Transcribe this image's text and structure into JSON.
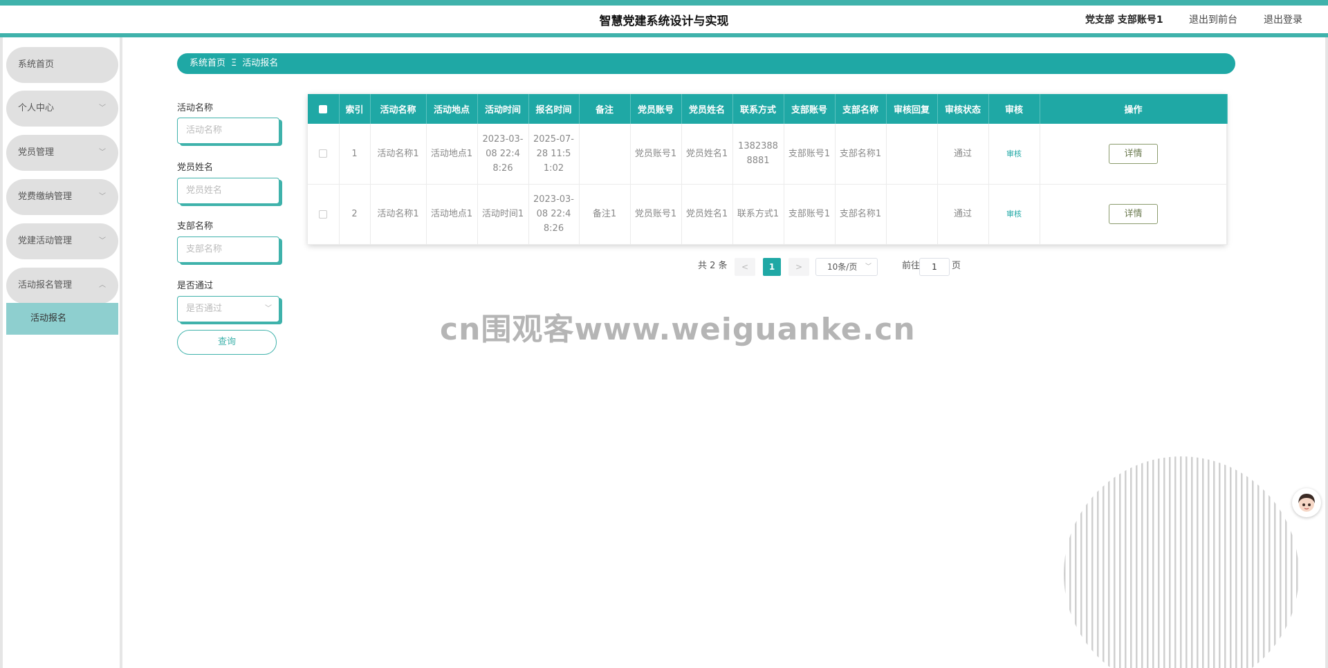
{
  "header": {
    "title": "智慧党建系统设计与实现",
    "user": "党支部 支部账号1",
    "to_front": "退出到前台",
    "logout": "退出登录"
  },
  "sidebar": {
    "items": [
      {
        "label": "系统首页",
        "has_arrow": false
      },
      {
        "label": "个人中心",
        "arrow": "﹀"
      },
      {
        "label": "党员管理",
        "arrow": "﹀"
      },
      {
        "label": "党费缴纳管理",
        "arrow": "﹀"
      },
      {
        "label": "党建活动管理",
        "arrow": "﹀"
      },
      {
        "label": "活动报名管理",
        "arrow": "︿"
      }
    ],
    "sub_item": "活动报名"
  },
  "breadcrumb": {
    "home": "系统首页",
    "separator": "Ξ",
    "current": "活动报名"
  },
  "search": {
    "fields": [
      {
        "label": "活动名称",
        "placeholder": "活动名称"
      },
      {
        "label": "党员姓名",
        "placeholder": "党员姓名"
      },
      {
        "label": "支部名称",
        "placeholder": "支部名称"
      },
      {
        "label": "是否通过",
        "placeholder": "是否通过"
      }
    ],
    "query_label": "查询"
  },
  "table": {
    "columns": [
      "索引",
      "活动名称",
      "活动地点",
      "活动时间",
      "报名时间",
      "备注",
      "党员账号",
      "党员姓名",
      "联系方式",
      "支部账号",
      "支部名称",
      "审核回复",
      "审核状态",
      "审核",
      "操作"
    ],
    "rows": [
      [
        "1",
        "活动名称1",
        "活动地点1",
        "2023-03-08 22:48:26",
        "2025-07-28 11:51:02",
        "",
        "党员账号1",
        "党员姓名1",
        "13823888881",
        "支部账号1",
        "支部名称1",
        "",
        "通过",
        "审核",
        "详情"
      ],
      [
        "2",
        "活动名称1",
        "活动地点1",
        "活动时间1",
        "2023-03-08 22:48:26",
        "备注1",
        "党员账号1",
        "党员姓名1",
        "联系方式1",
        "支部账号1",
        "支部名称1",
        "",
        "通过",
        "审核",
        "详情"
      ]
    ]
  },
  "pagination": {
    "total": "共 2 条",
    "prev": "<",
    "current_page": "1",
    "next": ">",
    "page_size": "10条/页",
    "goto_label": "前往",
    "goto_value": "1",
    "page_unit": "页"
  },
  "watermark": "cn围观客www.weiguanke.cn",
  "colors": {
    "accent": "#1fa8a5",
    "menu_bg": "#e0e0e0",
    "submenu_bg": "#8ecfcf"
  }
}
